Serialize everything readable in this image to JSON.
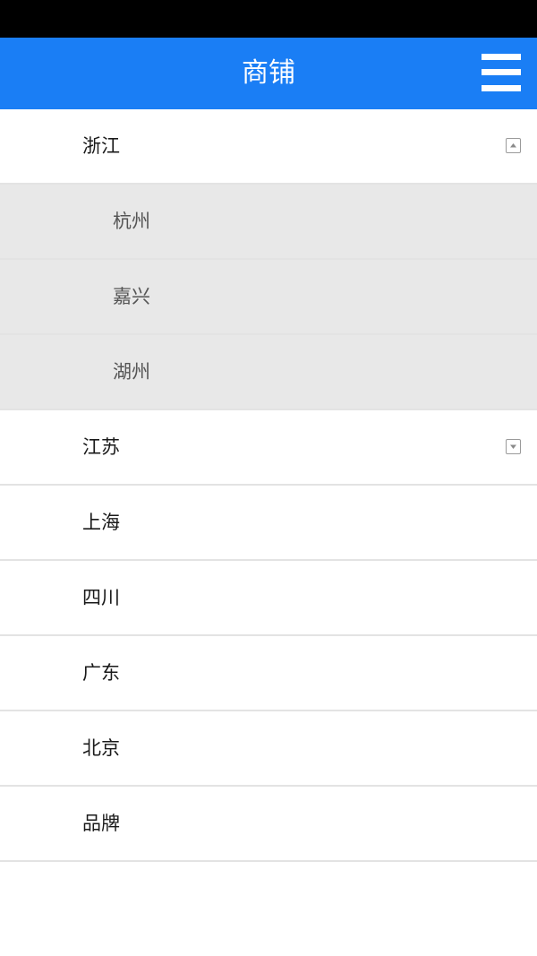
{
  "header": {
    "title": "商铺",
    "menu_icon": "hamburger-menu-icon"
  },
  "colors": {
    "nav_bar": "#1a7ef5",
    "status_bar": "#000000",
    "sub_row_bg": "#e8e8e8",
    "divider": "#e3e3e3"
  },
  "provinces": [
    {
      "label": "浙江",
      "expanded": true,
      "icon": "collapse-arrow-icon",
      "cities": [
        {
          "label": "杭州"
        },
        {
          "label": "嘉兴"
        },
        {
          "label": "湖州"
        }
      ]
    },
    {
      "label": "江苏",
      "expanded": false,
      "icon": "expand-arrow-icon"
    },
    {
      "label": "上海"
    },
    {
      "label": "四川"
    },
    {
      "label": "广东"
    },
    {
      "label": "北京"
    },
    {
      "label": "品牌"
    }
  ]
}
